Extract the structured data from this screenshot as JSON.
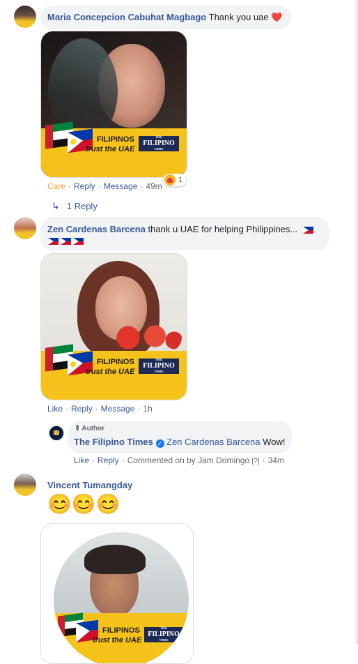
{
  "comments": [
    {
      "author": "Maria Concepcion Cabuhat Magbago",
      "text": "Thank you uae",
      "heart": "❤️",
      "frame": {
        "line1": "FILIPINOS",
        "line2": "trust the UAE",
        "brand_small": "THE",
        "brand": "FILIPINO",
        "brand_sub": "TIMES"
      },
      "actions": {
        "care": "Care",
        "reply": "Reply",
        "message": "Message",
        "time": "49m"
      },
      "reaction_count": "1",
      "replies_link": "1 Reply"
    },
    {
      "author": "Zen Cardenas Barcena",
      "text": "thank u UAE for helping Philippines...",
      "frame": {
        "line1": "FILIPINOS",
        "line2": "trust the UAE",
        "brand_small": "THE",
        "brand": "FILIPINO",
        "brand_sub": "TIMES"
      },
      "actions": {
        "like": "Like",
        "reply": "Reply",
        "message": "Message",
        "time": "1h"
      },
      "reply": {
        "badge": "Author",
        "author": "The Filipino Times",
        "mention": "Zen Cardenas Barcena",
        "text": "Wow!",
        "actions": {
          "like": "Like",
          "reply": "Reply",
          "commented_on_by": "Commented on by",
          "commenter": "Jam Domingo",
          "help": "[?]",
          "time": "34m"
        }
      }
    },
    {
      "author": "Vincent Tumangday",
      "emojis": "😊😊😊",
      "frame": {
        "line1": "FILIPINOS",
        "line2": "trust the UAE",
        "brand_small": "THE",
        "brand": "FILIPINO",
        "brand_sub": "TIMES"
      }
    }
  ],
  "colors": {
    "link": "#385898",
    "bubble": "#f2f3f5",
    "frame_yellow": "#f5c21b",
    "care": "#e8a33c",
    "verified": "#1877f2"
  }
}
